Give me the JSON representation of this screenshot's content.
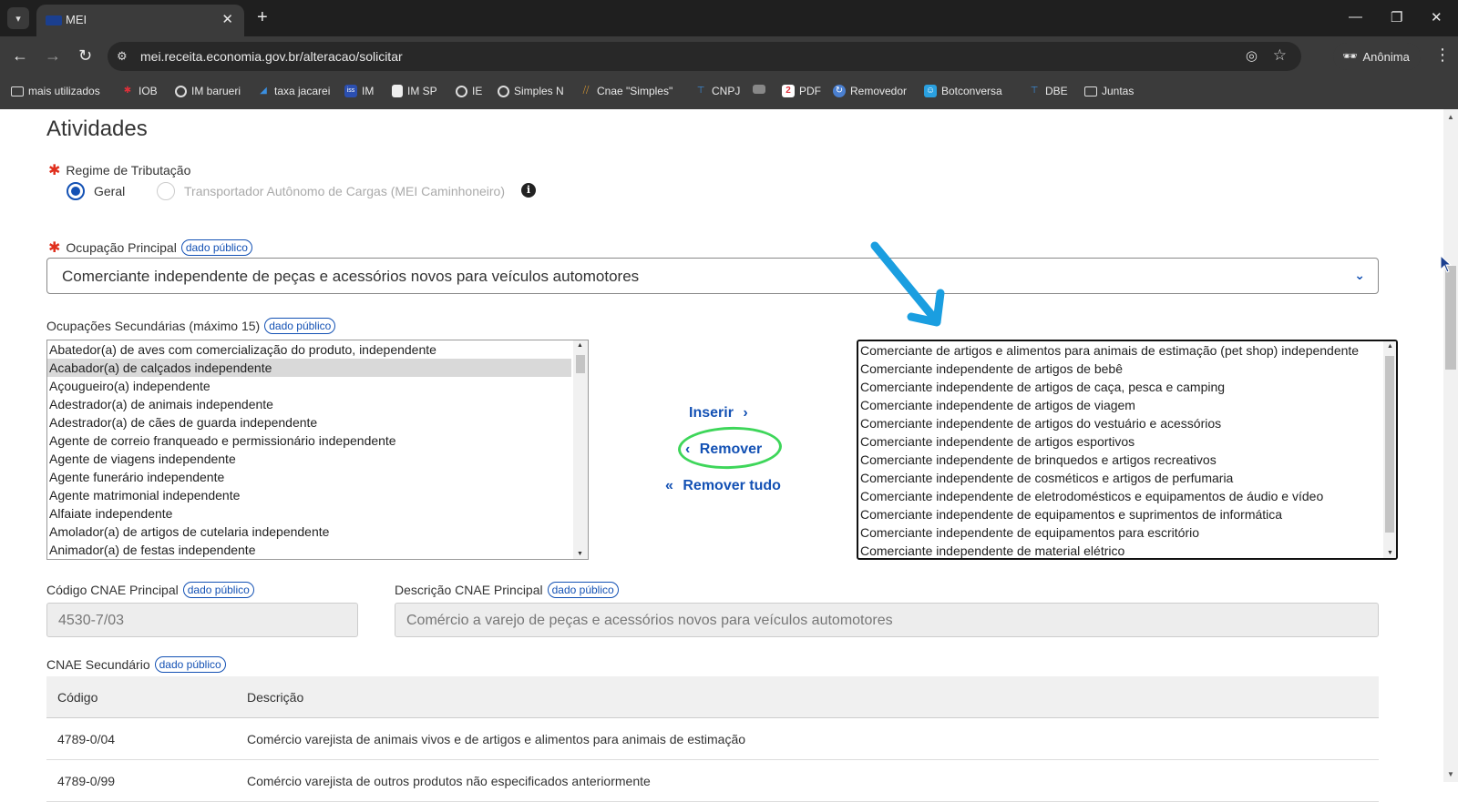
{
  "browser": {
    "tab_title": "MEI",
    "url": "mei.receita.economia.gov.br/alteracao/solicitar",
    "profile_label": "Anônima",
    "bookmarks": [
      "mais utilizados",
      "IOB",
      "IM barueri",
      "taxa jacarei",
      "IM",
      "IM SP",
      "IE",
      "Simples N",
      "Cnae \"Simples\"",
      "CNPJ",
      "PDF",
      "Removedor",
      "Botconversa",
      "DBE",
      "Juntas"
    ]
  },
  "section_title": "Atividades",
  "regime": {
    "label": "Regime de Tributação",
    "options": [
      "Geral",
      "Transportador Autônomo de Cargas (MEI Caminhoneiro)"
    ],
    "selected": "Geral"
  },
  "ocupacao_principal": {
    "label": "Ocupação Principal",
    "badge": "dado público",
    "value": "Comerciante independente de peças e acessórios novos para veículos automotores"
  },
  "ocupacoes_secundarias": {
    "label": "Ocupações Secundárias (máximo 15)",
    "badge": "dado público",
    "available": [
      "Abatedor(a) de aves com comercialização do produto, independente",
      "Acabador(a) de calçados independente",
      "Açougueiro(a) independente",
      "Adestrador(a) de animais independente",
      "Adestrador(a) de cães de guarda independente",
      "Agente de correio franqueado e permissionário independente",
      "Agente de viagens independente",
      "Agente funerário independente",
      "Agente matrimonial independente",
      "Alfaiate independente",
      "Amolador(a) de artigos de cutelaria independente",
      "Animador(a) de festas independente"
    ],
    "available_selected_index": 1,
    "chosen": [
      "Comerciante de artigos e alimentos para animais de estimação (pet shop) independente",
      "Comerciante independente de artigos de bebê",
      "Comerciante independente de artigos de caça, pesca e camping",
      "Comerciante independente de artigos de viagem",
      "Comerciante independente de artigos do vestuário e acessórios",
      "Comerciante independente de artigos esportivos",
      "Comerciante independente de brinquedos e artigos recreativos",
      "Comerciante independente de cosméticos e artigos de perfumaria",
      "Comerciante independente de eletrodomésticos e equipamentos de áudio e vídeo",
      "Comerciante independente de equipamentos e suprimentos de informática",
      "Comerciante independente de equipamentos para escritório",
      "Comerciante independente de material elétrico"
    ],
    "actions": {
      "inserir": "Inserir",
      "remover": "Remover",
      "remover_tudo": "Remover tudo"
    }
  },
  "cnae_principal": {
    "codigo_label": "Código CNAE Principal",
    "codigo_value": "4530-7/03",
    "descricao_label": "Descrição CNAE Principal",
    "descricao_value": "Comércio a varejo de peças e acessórios novos para veículos automotores",
    "badge": "dado público"
  },
  "cnae_secundario": {
    "label": "CNAE Secundário",
    "badge": "dado público",
    "columns": [
      "Código",
      "Descrição"
    ],
    "rows": [
      [
        "4789-0/04",
        "Comércio varejista de animais vivos e de artigos e alimentos para animais de estimação"
      ],
      [
        "4789-0/99",
        "Comércio varejista de outros produtos não especificados anteriormente"
      ]
    ]
  },
  "colors": {
    "accent": "#1351b4",
    "required": "#e0301e",
    "annotation_arrow": "#1a9ee0",
    "annotation_ring": "#3ed65a"
  }
}
